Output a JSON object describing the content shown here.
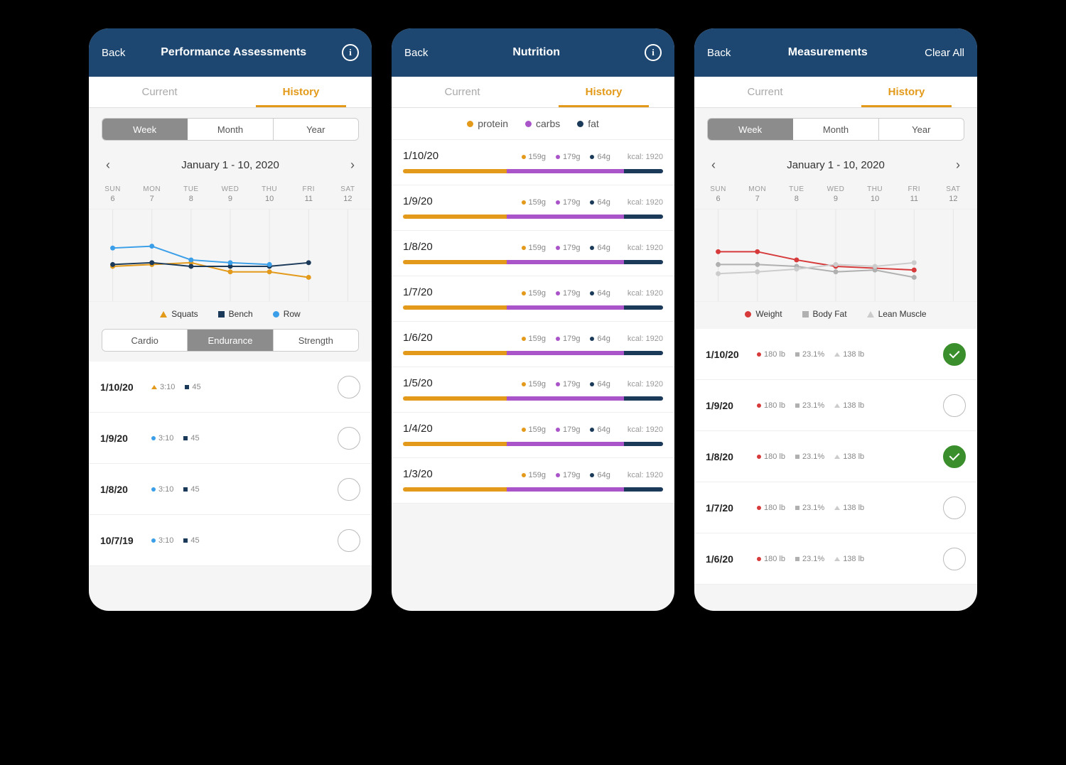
{
  "colors": {
    "orange": "#e39a1a",
    "navy": "#1b3a5a",
    "purple": "#a954c9",
    "lightBlue": "#3a9fe8",
    "red": "#d63a3a",
    "gray": "#b0b0b0",
    "green": "#3a8f2c"
  },
  "tabs": {
    "current": "Current",
    "history": "History"
  },
  "period": {
    "week": "Week",
    "month": "Month",
    "year": "Year"
  },
  "dateRange": "January 1 - 10, 2020",
  "days": [
    {
      "dow": "SUN",
      "num": "6"
    },
    {
      "dow": "MON",
      "num": "7"
    },
    {
      "dow": "TUE",
      "num": "8"
    },
    {
      "dow": "WED",
      "num": "9"
    },
    {
      "dow": "THU",
      "num": "10"
    },
    {
      "dow": "FRI",
      "num": "11"
    },
    {
      "dow": "SAT",
      "num": "12"
    }
  ],
  "perf": {
    "back": "Back",
    "title": "Performance Assessments",
    "legend": {
      "squats": "Squats",
      "bench": "Bench",
      "row": "Row"
    },
    "categories": {
      "cardio": "Cardio",
      "endurance": "Endurance",
      "strength": "Strength"
    },
    "rows": [
      {
        "date": "1/10/20",
        "m1_icon": "tri",
        "m1_color": "#e39a1a",
        "m1": "3:10",
        "m2_icon": "sq",
        "m2_color": "#1b3a5a",
        "m2": "45"
      },
      {
        "date": "1/9/20",
        "m1_icon": "dot",
        "m1_color": "#3a9fe8",
        "m1": "3:10",
        "m2_icon": "sq",
        "m2_color": "#1b3a5a",
        "m2": "45"
      },
      {
        "date": "1/8/20",
        "m1_icon": "dot",
        "m1_color": "#3a9fe8",
        "m1": "3:10",
        "m2_icon": "sq",
        "m2_color": "#1b3a5a",
        "m2": "45"
      },
      {
        "date": "10/7/19",
        "m1_icon": "dot",
        "m1_color": "#3a9fe8",
        "m1": "3:10",
        "m2_icon": "sq",
        "m2_color": "#1b3a5a",
        "m2": "45"
      }
    ]
  },
  "nutrition": {
    "back": "Back",
    "title": "Nutrition",
    "legend": {
      "protein": "protein",
      "carbs": "carbs",
      "fat": "fat"
    },
    "kcalPrefix": "kcal: ",
    "rows": [
      {
        "date": "1/10/20",
        "protein": "159g",
        "carbs": "179g",
        "fat": "64g",
        "kcal": "1920"
      },
      {
        "date": "1/9/20",
        "protein": "159g",
        "carbs": "179g",
        "fat": "64g",
        "kcal": "1920"
      },
      {
        "date": "1/8/20",
        "protein": "159g",
        "carbs": "179g",
        "fat": "64g",
        "kcal": "1920"
      },
      {
        "date": "1/7/20",
        "protein": "159g",
        "carbs": "179g",
        "fat": "64g",
        "kcal": "1920"
      },
      {
        "date": "1/6/20",
        "protein": "159g",
        "carbs": "179g",
        "fat": "64g",
        "kcal": "1920"
      },
      {
        "date": "1/5/20",
        "protein": "159g",
        "carbs": "179g",
        "fat": "64g",
        "kcal": "1920"
      },
      {
        "date": "1/4/20",
        "protein": "159g",
        "carbs": "179g",
        "fat": "64g",
        "kcal": "1920"
      },
      {
        "date": "1/3/20",
        "protein": "159g",
        "carbs": "179g",
        "fat": "64g",
        "kcal": "1920"
      }
    ],
    "barPct": {
      "protein": 40,
      "carbs": 45,
      "fat": 15
    }
  },
  "meas": {
    "back": "Back",
    "title": "Measurements",
    "clear": "Clear All",
    "legend": {
      "weight": "Weight",
      "bodyfat": "Body Fat",
      "lean": "Lean Muscle"
    },
    "rows": [
      {
        "date": "1/10/20",
        "weight": "180 lb",
        "bodyfat": "23.1%",
        "lean": "138 lb",
        "checked": true
      },
      {
        "date": "1/9/20",
        "weight": "180 lb",
        "bodyfat": "23.1%",
        "lean": "138 lb",
        "checked": false
      },
      {
        "date": "1/8/20",
        "weight": "180 lb",
        "bodyfat": "23.1%",
        "lean": "138 lb",
        "checked": true
      },
      {
        "date": "1/7/20",
        "weight": "180 lb",
        "bodyfat": "23.1%",
        "lean": "138 lb",
        "checked": false
      },
      {
        "date": "1/6/20",
        "weight": "180 lb",
        "bodyfat": "23.1%",
        "lean": "138 lb",
        "checked": false
      }
    ]
  },
  "chart_data": [
    {
      "type": "line",
      "title": "Performance Assessments — Endurance (Week)",
      "categories": [
        "SUN 6",
        "MON 7",
        "TUE 8",
        "WED 9",
        "THU 10",
        "FRI 11",
        "SAT 12"
      ],
      "series": [
        {
          "name": "Squats",
          "color": "#e39a1a",
          "values": [
            62,
            60,
            58,
            68,
            68,
            74,
            null
          ]
        },
        {
          "name": "Bench",
          "color": "#1b3a5a",
          "values": [
            60,
            58,
            62,
            62,
            62,
            58,
            null
          ]
        },
        {
          "name": "Row",
          "color": "#3a9fe8",
          "values": [
            42,
            40,
            55,
            58,
            60,
            null,
            null
          ]
        }
      ],
      "ylim": [
        0,
        100
      ]
    },
    {
      "type": "line",
      "title": "Measurements (Week)",
      "categories": [
        "SUN 6",
        "MON 7",
        "TUE 8",
        "WED 9",
        "THU 10",
        "FRI 11",
        "SAT 12"
      ],
      "series": [
        {
          "name": "Weight",
          "color": "#d63a3a",
          "values": [
            46,
            46,
            55,
            62,
            64,
            66,
            null
          ]
        },
        {
          "name": "Body Fat",
          "color": "#b0b0b0",
          "values": [
            60,
            60,
            62,
            68,
            66,
            74,
            null
          ]
        },
        {
          "name": "Lean Muscle",
          "color": "#cccccc",
          "values": [
            70,
            68,
            65,
            60,
            62,
            58,
            null
          ]
        }
      ],
      "ylim": [
        0,
        100
      ]
    }
  ]
}
